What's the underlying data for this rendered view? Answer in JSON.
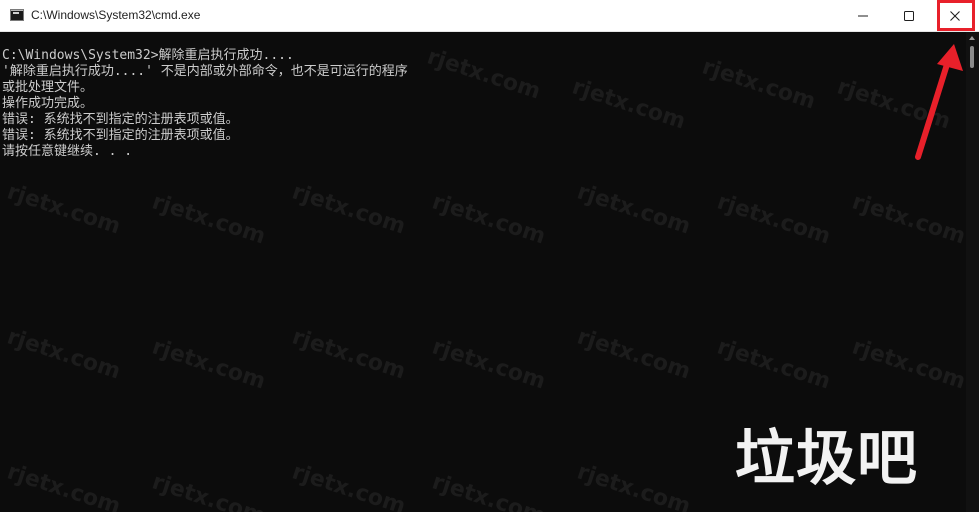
{
  "window": {
    "title": "C:\\Windows\\System32\\cmd.exe"
  },
  "controls": {
    "minimize_icon": "minimize-icon",
    "maximize_icon": "maximize-icon",
    "close_icon": "close-icon",
    "highlight_color": "#e8202a"
  },
  "terminal": {
    "lines": [
      "C:\\Windows\\System32>解除重启执行成功....",
      "'解除重启执行成功....' 不是内部或外部命令，也不是可运行的程序",
      "或批处理文件。",
      "操作成功完成。",
      "错误: 系统找不到指定的注册表项或值。",
      "错误: 系统找不到指定的注册表项或值。",
      "请按任意键继续. . ."
    ],
    "text_color": "#cccccc",
    "background": "#0c0c0c"
  },
  "watermark": {
    "text": "rjetx.com"
  },
  "overlay": {
    "text": "垃圾吧"
  }
}
